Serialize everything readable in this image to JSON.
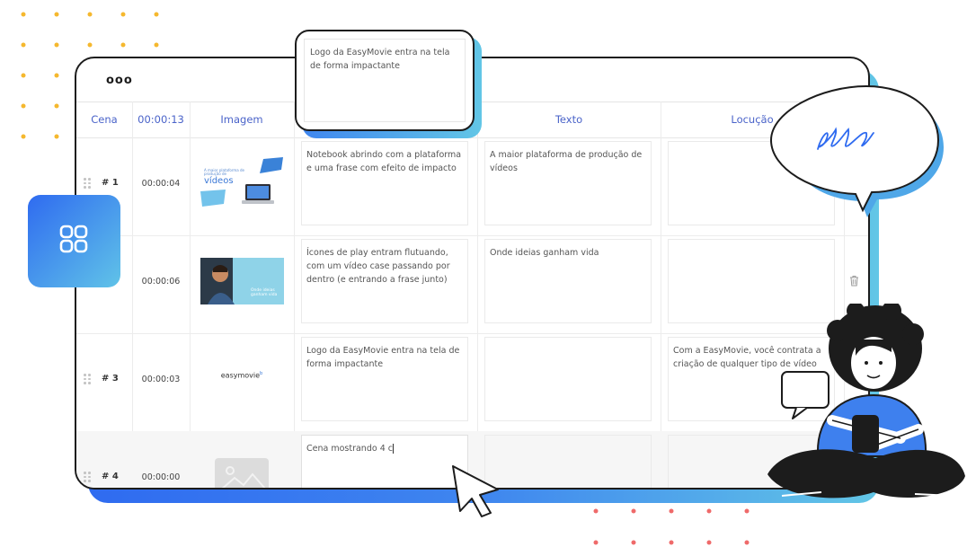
{
  "window": {
    "dots": "ooo"
  },
  "columns": [
    "Cena",
    "00:00:13",
    "Imagem",
    "Texto",
    "Locução"
  ],
  "popup": {
    "text": "Logo da EasyMovie entra na tela de forma impactante"
  },
  "rows": [
    {
      "number": "# 1",
      "time": "00:00:04",
      "image": {
        "caption_small": "A maior plataforma de produção de",
        "caption_big": "vídeos"
      },
      "description": "Notebook abrindo com a plataforma e uma frase com efeito de impacto",
      "text": "A maior plataforma de produção de vídeos",
      "voiceover": ""
    },
    {
      "number": "",
      "time": "00:00:06",
      "image": {
        "caption": "Onde ideias ganham vida"
      },
      "description": "Ícones de play entram flutuando, com um vídeo case passando por dentro (e entrando a frase junto)",
      "text": "Onde ideias ganham vida",
      "voiceover": ""
    },
    {
      "number": "# 3",
      "time": "00:00:03",
      "image": {
        "logo": "easymovie"
      },
      "description": "Logo da EasyMovie entra na tela de forma impactante",
      "text": "",
      "voiceover": "Com a EasyMovie, você contrata a criação de qualquer tipo de vídeo"
    },
    {
      "number": "# 4",
      "time": "00:00:00",
      "image": {
        "placeholder": "image-placeholder-icon"
      },
      "description": "Cena mostrando 4 c",
      "text": "",
      "voiceover": ""
    }
  ],
  "icons": {
    "app": "grid-icon",
    "delete": "trash-icon",
    "cursor": "mouse-cursor-icon",
    "speech": "speech-bubble-icon",
    "signature": "handwriting-scribble"
  },
  "colors": {
    "accent_blue": "#3468ec",
    "accent_cyan": "#5ec3e6",
    "header_text": "#4a63c9",
    "dot_yellow": "#f5b82e",
    "dot_red": "#ef6a6a",
    "outline": "#1c1c1c"
  }
}
